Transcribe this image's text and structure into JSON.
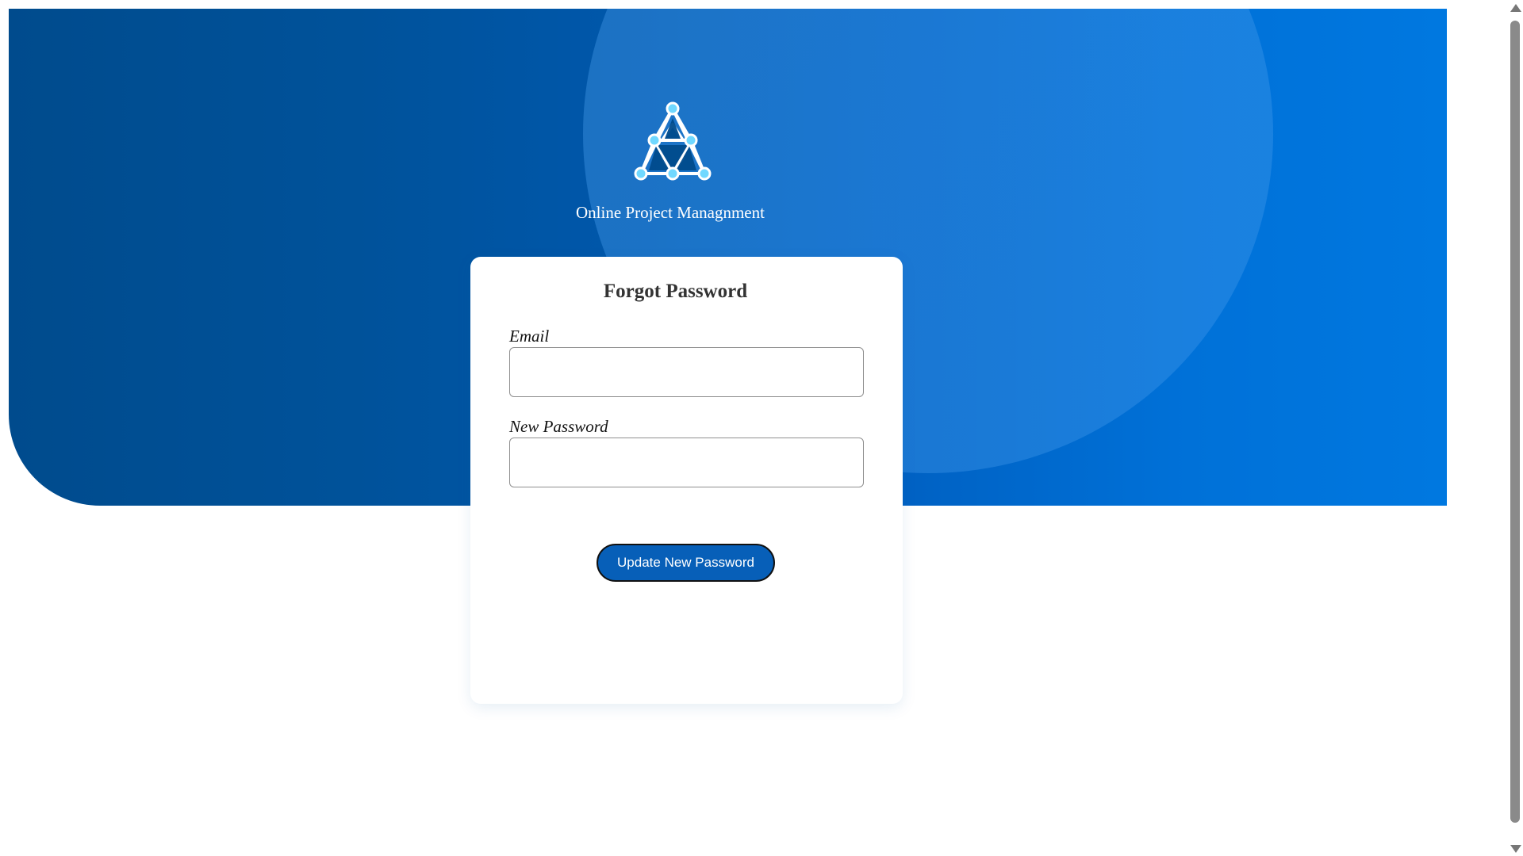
{
  "app": {
    "title": "Online Project Managnment",
    "logo_icon": "network-triangle-icon"
  },
  "forgot_password": {
    "title": "Forgot Password",
    "email_label": "Email",
    "email_value": "",
    "email_placeholder": "",
    "new_password_label": "New Password",
    "new_password_value": "",
    "new_password_placeholder": "",
    "submit_label": "Update New Password"
  },
  "colors": {
    "hero_dark": "#004b8d",
    "hero_light": "#0078e0",
    "button": "#075fb8",
    "card": "#ffffff",
    "title_text": "#333333"
  },
  "icons": {
    "scroll_up": "chevron-up-icon",
    "scroll_down": "chevron-down-icon"
  }
}
